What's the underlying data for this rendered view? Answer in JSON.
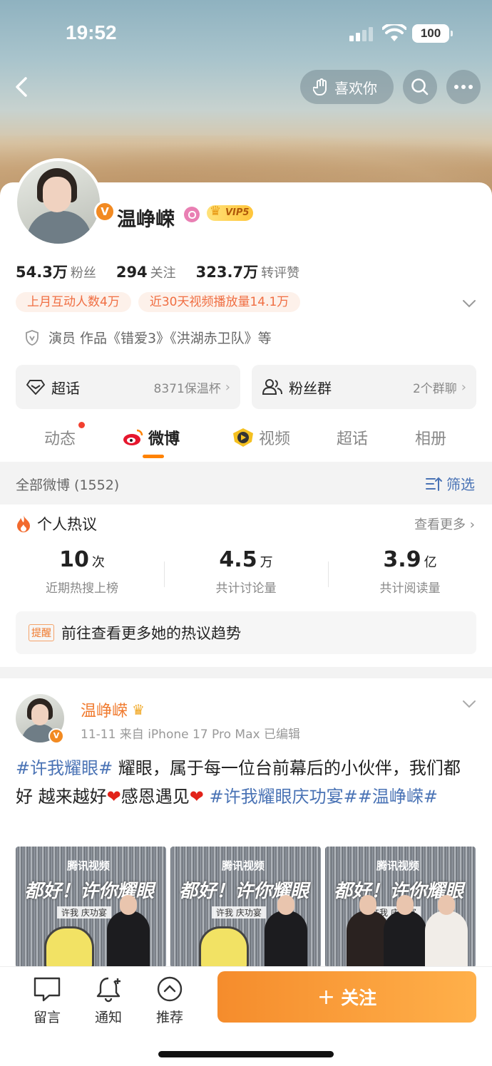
{
  "status_bar": {
    "time": "19:52",
    "battery": "100"
  },
  "header": {
    "like_label": "喜欢你"
  },
  "profile": {
    "name": "温峥嵘",
    "vip_label": "VIP5",
    "stats": [
      {
        "value": "54.3万",
        "label": "粉丝"
      },
      {
        "value": "294",
        "label": "关注"
      },
      {
        "value": "323.7万",
        "label": "转评赞"
      }
    ],
    "tags": [
      "上月互动人数4万",
      "近30天视频播放量14.1万"
    ],
    "bio": "演员 作品《错爱3》《洪湖赤卫队》等",
    "cards": [
      {
        "label": "超话",
        "value": "8371保温杯"
      },
      {
        "label": "粉丝群",
        "value": "2个群聊"
      }
    ]
  },
  "tabs": [
    {
      "label": "动态"
    },
    {
      "label": "微博"
    },
    {
      "label": "视频"
    },
    {
      "label": "超话"
    },
    {
      "label": "相册"
    }
  ],
  "filter": {
    "count_label": "全部微博 (1552)",
    "filter_label": "筛选"
  },
  "hot": {
    "title": "个人热议",
    "more": "查看更多",
    "stats": [
      {
        "num": "10",
        "unit": "次",
        "label": "近期热搜上榜"
      },
      {
        "num": "4.5",
        "unit": "万",
        "label": "共计讨论量"
      },
      {
        "num": "3.9",
        "unit": "亿",
        "label": "共计阅读量"
      }
    ],
    "reminder_tag": "提醒",
    "reminder_text": "前往查看更多她的热议趋势"
  },
  "post": {
    "author": "温峥嵘",
    "meta": "11-11  来自 iPhone 17 Pro Max  已编辑",
    "hashtag1": "#许我耀眼#",
    "text1": " 耀眼，属于每一位台前幕后的小伙伴，我们都好  越来越好",
    "text2": "感恩遇见",
    "hashtag2": "#许我耀眼庆功宴#",
    "hashtag3": "#温峥嵘#",
    "image_logo": "腾讯视频",
    "image_banner": "都好！许你耀眼",
    "image_sub": "许我      庆功宴"
  },
  "bottom_bar": {
    "comment": "留言",
    "notify": "通知",
    "recommend": "推荐",
    "follow": "关注"
  },
  "colors": {
    "accent": "#ff8200",
    "link": "#4a73b5",
    "follow_start": "#f58c2c",
    "follow_end": "#ffb04a"
  }
}
